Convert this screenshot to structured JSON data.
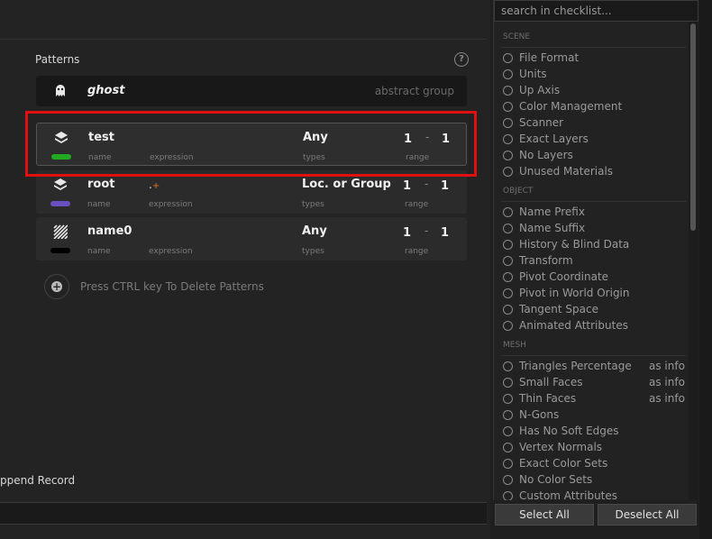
{
  "patterns": {
    "title": "Patterns",
    "help_icon": "question-circle-icon",
    "rows": [
      {
        "name": "ghost",
        "note": "abstract group",
        "icon": "ghost-icon"
      },
      {
        "name": "test",
        "expression": "",
        "types": "Any",
        "range_min": "1",
        "range_sep": "-",
        "range_max": "1",
        "color": "#22aa22",
        "icon": "layers-icon",
        "selected": true
      },
      {
        "name": "root",
        "expression": ".",
        "expression_suffix": "+",
        "types": "Loc. or Group",
        "range_min": "1",
        "range_sep": "-",
        "range_max": "1",
        "color": "#6a4fc0",
        "icon": "layers-icon"
      },
      {
        "name": "name0",
        "expression": "",
        "types": "Any",
        "range_min": "1",
        "range_sep": "-",
        "range_max": "1",
        "color": "#000000",
        "icon": "hatched-icon"
      }
    ],
    "col_labels": {
      "name": "name",
      "expression": "expression",
      "types": "types",
      "range": "range"
    },
    "add_hint": "Press CTRL key To Delete Patterns",
    "add_icon": "plus-circle-icon",
    "append_record": "ppend Record"
  },
  "checklist": {
    "search_placeholder": "search in checklist...",
    "sections": [
      {
        "title": "SCENE",
        "items": [
          {
            "label": "File Format"
          },
          {
            "label": "Units"
          },
          {
            "label": "Up Axis"
          },
          {
            "label": "Color Management"
          },
          {
            "label": "Scanner"
          },
          {
            "label": "Exact Layers"
          },
          {
            "label": "No Layers"
          },
          {
            "label": "Unused Materials"
          }
        ]
      },
      {
        "title": "OBJECT",
        "items": [
          {
            "label": "Name Prefix"
          },
          {
            "label": "Name Suffix"
          },
          {
            "label": "History & Blind Data"
          },
          {
            "label": "Transform"
          },
          {
            "label": "Pivot Coordinate"
          },
          {
            "label": "Pivot in World Origin"
          },
          {
            "label": "Tangent Space"
          },
          {
            "label": "Animated Attributes"
          }
        ]
      },
      {
        "title": "MESH",
        "items": [
          {
            "label": "Triangles Percentage",
            "extra": "as info"
          },
          {
            "label": "Small Faces",
            "extra": "as info"
          },
          {
            "label": "Thin Faces",
            "extra": "as info"
          },
          {
            "label": "N-Gons"
          },
          {
            "label": "Has No Soft Edges"
          },
          {
            "label": "Vertex Normals"
          },
          {
            "label": "Exact Color Sets"
          },
          {
            "label": "No Color Sets"
          },
          {
            "label": "Custom Attributes"
          }
        ]
      }
    ],
    "select_all": "Select All",
    "deselect_all": "Deselect All"
  }
}
